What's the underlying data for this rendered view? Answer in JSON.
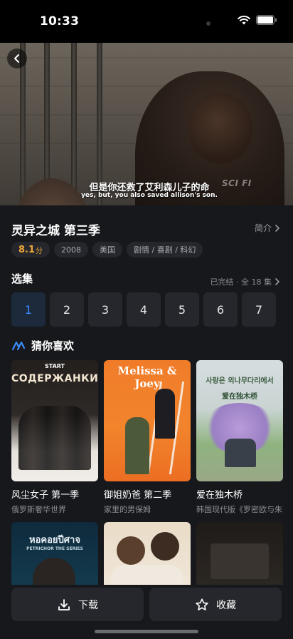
{
  "status_bar": {
    "time": "10:33"
  },
  "video": {
    "subtitle_cn": "但是你还救了艾利森儿子的命",
    "subtitle_en": "yes, but, you also saved allison's son.",
    "watermark": "SCI FI"
  },
  "show": {
    "title": "灵异之城 第三季",
    "intro_label": "简介",
    "rating": "8.1",
    "rating_unit": "分",
    "year": "2008",
    "region": "美国",
    "genres": "剧情 / 喜剧 / 科幻"
  },
  "episodes": {
    "title": "选集",
    "status": "已完结 · 全 18 集",
    "items": [
      "1",
      "2",
      "3",
      "4",
      "5",
      "6",
      "7"
    ]
  },
  "recommendations": {
    "title": "猜你喜欢",
    "items": [
      {
        "title": "风尘女子 第一季",
        "subtitle": "俄罗斯奢华世界",
        "poster_text": "СОДЕРЖАНКИ",
        "poster_top": "START"
      },
      {
        "title": "御姐奶爸 第二季",
        "subtitle": "家里的男保姆",
        "poster_text": "Melissa & Joey"
      },
      {
        "title": "爱在独木桥",
        "subtitle": "韩国现代版《罗密欧与朱丽叶》",
        "poster_text": "사랑은 외나무다리에서",
        "poster_sub": "爱在独木桥"
      },
      {
        "title": "",
        "subtitle": "",
        "poster_text": "หอคอยปีศาจ",
        "poster_sub": "PETRICHOR THE SERIES"
      },
      {
        "title": "",
        "subtitle": "",
        "poster_text": ""
      },
      {
        "title": "",
        "subtitle": "",
        "poster_text": ""
      }
    ]
  },
  "bottom_bar": {
    "download_label": "下载",
    "favorite_label": "收藏"
  },
  "colors": {
    "accent": "#3b8cff",
    "rating": "#f0a83a",
    "background": "#17181c",
    "chip": "#26272c"
  }
}
